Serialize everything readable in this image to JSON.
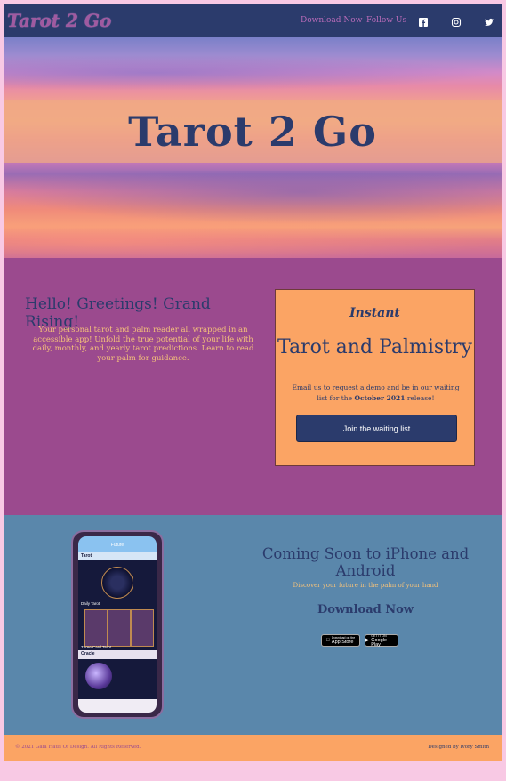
{
  "nav": {
    "logo": "Tarot 2 Go",
    "links": [
      "Download Now",
      "Follow Us"
    ],
    "icons": [
      "facebook-icon",
      "instagram-icon",
      "twitter-icon"
    ]
  },
  "hero": {
    "title": "Tarot 2 Go"
  },
  "intro": {
    "greeting": "Hello! Greetings! Grand Rising!",
    "text": "Your personal tarot and palm reader all wrapped in an accessible app! Unfold the true potential of your life with daily, monthly, and yearly tarot predictions. Learn to read your palm for guidance."
  },
  "card": {
    "kicker": "Instant",
    "title": "Tarot and Palmistry",
    "text_before": "Email us to request a demo and be in our waiting list for the ",
    "text_bold": "October 2021",
    "text_after": " release!",
    "button": "Join the waiting list"
  },
  "phone_screen": {
    "header": "Future",
    "section1": "Tarot",
    "section2": "Daily Tarot",
    "section3": "Three Card Tarot",
    "section4": "Oracle"
  },
  "app": {
    "title": "Coming Soon to iPhone and Android",
    "subtitle": "Discover your future in the palm of your hand",
    "download_title": "Download Now",
    "badges": {
      "apple_small": "Download on the",
      "apple": "App Store",
      "google_small": "GET IT ON",
      "google": "Google Play"
    }
  },
  "footer": {
    "copyright": "© 2021 Gaia Haus Of Design. All Rights Reserved.",
    "credit": "Designed by Ivory Smith"
  },
  "colors": {
    "navy": "#2b3b6c",
    "plum": "#9b4a8e",
    "orange": "#fba464",
    "steel_blue": "#5a87ab",
    "pink": "#f8c9e4"
  }
}
